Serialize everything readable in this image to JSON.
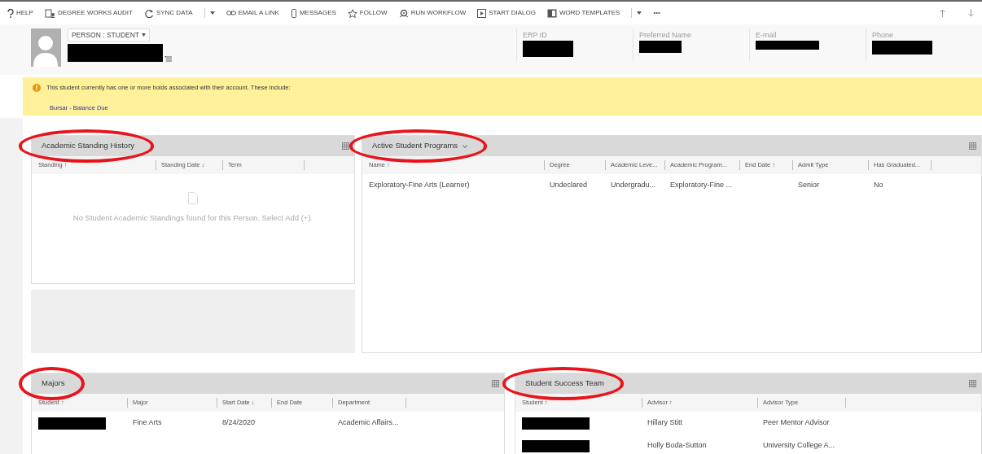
{
  "toolbar": {
    "items": [
      {
        "label": "HELP",
        "dropdown": false
      },
      {
        "label": "DEGREE WORKS AUDIT",
        "dropdown": false
      },
      {
        "label": "SYNC DATA",
        "dropdown": true
      },
      {
        "label": "EMAIL A LINK",
        "dropdown": false
      },
      {
        "label": "MESSAGES",
        "dropdown": false
      },
      {
        "label": "FOLLOW",
        "dropdown": false
      },
      {
        "label": "RUN WORKFLOW",
        "dropdown": false
      },
      {
        "label": "START DIALOG",
        "dropdown": false
      },
      {
        "label": "WORD TEMPLATES",
        "dropdown": true
      }
    ],
    "more": "•••"
  },
  "header": {
    "form_selector": "PERSON : STUDENT",
    "fields": [
      {
        "label": "ERP ID"
      },
      {
        "label": "Preferred Name"
      },
      {
        "label": "E-mail"
      },
      {
        "label": "Phone"
      }
    ]
  },
  "notice": {
    "message": "This student currently has one or more holds associated with their account. These include:",
    "links": [
      "Bursar - Balance Due"
    ]
  },
  "panels": [
    {
      "title": "Academic Standing History",
      "circled": true,
      "title_dropdown": false,
      "columns": [
        "Standing ↑",
        "Standing Date ↓",
        "Term"
      ],
      "empty_message": "No Student Academic Standings found for this Person. Select Add (+)."
    },
    {
      "title": "Active Student Programs",
      "circled": true,
      "title_dropdown": true,
      "columns": [
        "Name ↑",
        "Degree",
        "Academic Leve...",
        "Academic Program...",
        "End Date ↑",
        "Admit Type",
        "Has Graduated..."
      ],
      "rows": [
        [
          {
            "kind": "text",
            "text": "Exploratory-Fine Arts (Learner)"
          },
          {
            "kind": "text",
            "text": "Undeclared"
          },
          {
            "kind": "text",
            "text": "Undergradu..."
          },
          {
            "kind": "text",
            "text": "Exploratory-Fine ..."
          },
          {
            "kind": "empty"
          },
          {
            "kind": "text",
            "text": "Senior"
          },
          {
            "kind": "text",
            "text": "No"
          }
        ]
      ]
    },
    {
      "title": "Majors",
      "circled": true,
      "title_dropdown": false,
      "columns": [
        "Student ↑",
        "Major",
        "Start Date ↓",
        "End Date",
        "Department"
      ],
      "rows": [
        [
          {
            "kind": "redacted"
          },
          {
            "kind": "text",
            "text": "Fine Arts"
          },
          {
            "kind": "text",
            "text": "8/24/2020"
          },
          {
            "kind": "empty"
          },
          {
            "kind": "text",
            "text": "Academic Affairs..."
          }
        ]
      ]
    },
    {
      "title": "Student Success Team",
      "circled": true,
      "title_dropdown": false,
      "columns": [
        "Student ↑",
        "Advisor ↑",
        "Advisor Type"
      ],
      "rows": [
        [
          {
            "kind": "redacted"
          },
          {
            "kind": "text",
            "text": "Hillary Stitt"
          },
          {
            "kind": "text",
            "text": "Peer Mentor Advisor"
          }
        ],
        [
          {
            "kind": "redacted"
          },
          {
            "kind": "text",
            "text": "Holly Boda-Sutton"
          },
          {
            "kind": "text",
            "text": "University College A..."
          }
        ]
      ]
    }
  ]
}
